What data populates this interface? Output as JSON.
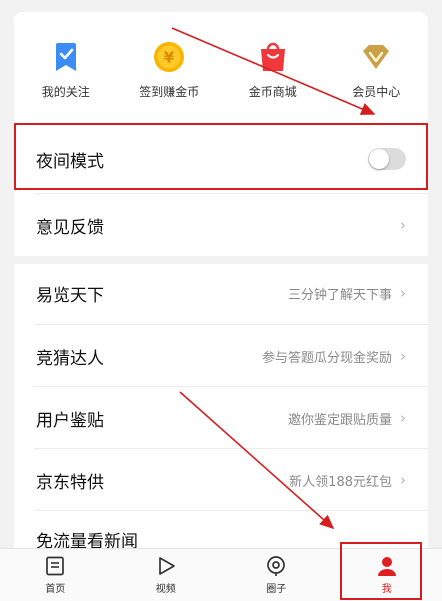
{
  "colors": {
    "accent": "#e02020",
    "annotation": "#d71e1e"
  },
  "quick_actions": [
    {
      "label": "我的关注",
      "icon": "bookmark-icon"
    },
    {
      "label": "签到赚金币",
      "icon": "gold-coin-icon"
    },
    {
      "label": "金币商城",
      "icon": "shopping-bag-icon"
    },
    {
      "label": "会员中心",
      "icon": "vip-diamond-icon"
    }
  ],
  "settings": {
    "night_mode": {
      "label": "夜间模式",
      "enabled": false
    },
    "feedback": {
      "label": "意见反馈"
    }
  },
  "menu": [
    {
      "label": "易览天下",
      "sub": "三分钟了解天下事"
    },
    {
      "label": "竞猜达人",
      "sub": "参与答题瓜分现金奖励"
    },
    {
      "label": "用户鉴贴",
      "sub": "邀你鉴定跟贴质量"
    },
    {
      "label": "京东特供",
      "sub": "新人领188元红包"
    },
    {
      "label": "免流量看新闻",
      "sub": ""
    }
  ],
  "tabbar": {
    "items": [
      {
        "label": "首页",
        "icon": "home-doc-icon"
      },
      {
        "label": "视频",
        "icon": "play-icon"
      },
      {
        "label": "圈子",
        "icon": "circle-pin-icon"
      },
      {
        "label": "我",
        "icon": "user-icon",
        "active": true
      }
    ]
  }
}
